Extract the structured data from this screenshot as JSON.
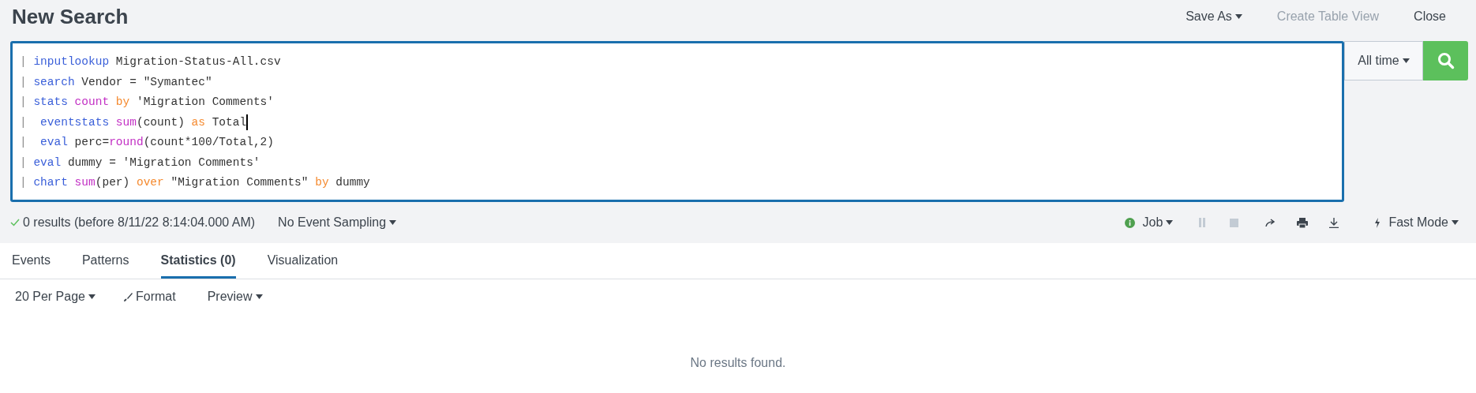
{
  "header": {
    "title": "New Search",
    "actions": [
      {
        "label": "Save As",
        "kind": "dropdown",
        "disabled": false
      },
      {
        "label": "Create Table View",
        "kind": "link",
        "disabled": true
      },
      {
        "label": "Close",
        "kind": "link",
        "disabled": false
      }
    ]
  },
  "query": {
    "lines": [
      {
        "cursor": false,
        "tokens": [
          {
            "text": "| ",
            "kind": "pipe"
          },
          {
            "text": "inputlookup",
            "kind": "command"
          },
          {
            "text": " Migration-Status-All.csv",
            "kind": "plain"
          }
        ]
      },
      {
        "cursor": false,
        "tokens": [
          {
            "text": "| ",
            "kind": "pipe"
          },
          {
            "text": "search",
            "kind": "command"
          },
          {
            "text": " Vendor = \"Symantec\"",
            "kind": "plain"
          }
        ]
      },
      {
        "cursor": false,
        "tokens": [
          {
            "text": "| ",
            "kind": "pipe"
          },
          {
            "text": "stats",
            "kind": "command"
          },
          {
            "text": " count",
            "kind": "function"
          },
          {
            "text": " by",
            "kind": "keyword"
          },
          {
            "text": " 'Migration Comments'",
            "kind": "plain"
          }
        ]
      },
      {
        "cursor": true,
        "tokens": [
          {
            "text": "|  ",
            "kind": "pipe"
          },
          {
            "text": "eventstats",
            "kind": "command"
          },
          {
            "text": " sum",
            "kind": "function"
          },
          {
            "text": "(count) ",
            "kind": "plain"
          },
          {
            "text": "as",
            "kind": "keyword"
          },
          {
            "text": " Total",
            "kind": "plain"
          }
        ]
      },
      {
        "cursor": false,
        "tokens": [
          {
            "text": "|  ",
            "kind": "pipe"
          },
          {
            "text": "eval",
            "kind": "command"
          },
          {
            "text": " perc=",
            "kind": "plain"
          },
          {
            "text": "round",
            "kind": "function"
          },
          {
            "text": "(count*100/Total,2)",
            "kind": "plain"
          }
        ]
      },
      {
        "cursor": false,
        "tokens": [
          {
            "text": "| ",
            "kind": "pipe"
          },
          {
            "text": "eval",
            "kind": "command"
          },
          {
            "text": " dummy = 'Migration Comments'",
            "kind": "plain"
          }
        ]
      },
      {
        "cursor": false,
        "tokens": [
          {
            "text": "| ",
            "kind": "pipe"
          },
          {
            "text": "chart",
            "kind": "command"
          },
          {
            "text": " sum",
            "kind": "function"
          },
          {
            "text": "(per) ",
            "kind": "plain"
          },
          {
            "text": "over",
            "kind": "keyword"
          },
          {
            "text": " \"Migration Comments\" ",
            "kind": "plain"
          },
          {
            "text": "by",
            "kind": "keyword"
          },
          {
            "text": " dummy",
            "kind": "plain"
          }
        ]
      }
    ],
    "time_range": "All time"
  },
  "status": {
    "summary": "0 results (before 8/11/22 8:14:04.000 AM)",
    "sampling": "No Event Sampling",
    "job": "Job",
    "mode": "Fast Mode"
  },
  "tabs": [
    {
      "label": "Events",
      "selected": false
    },
    {
      "label": "Patterns",
      "selected": false
    },
    {
      "label": "Statistics (0)",
      "selected": true
    },
    {
      "label": "Visualization",
      "selected": false
    }
  ],
  "toolbar": {
    "per_page": "20 Per Page",
    "format": "Format",
    "preview": "Preview"
  },
  "empty_message": "No results found."
}
